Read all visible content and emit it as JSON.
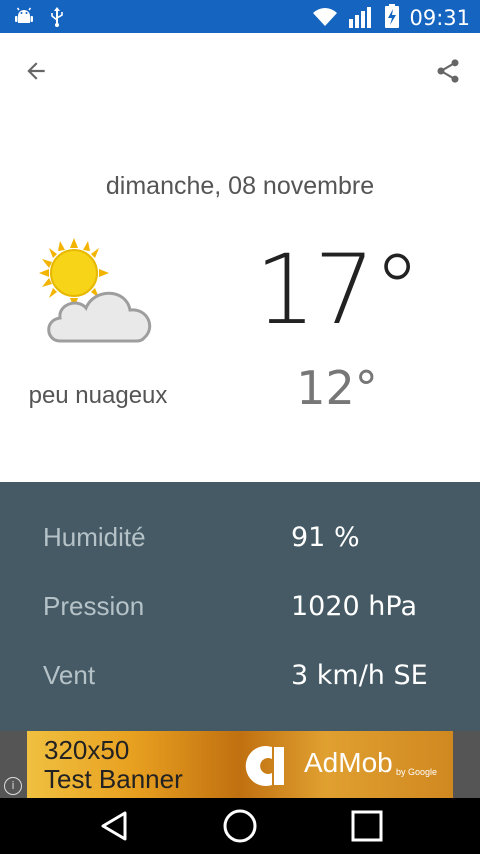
{
  "status_bar": {
    "time": "09:31",
    "icons": [
      "android-debug-icon",
      "usb-icon",
      "wifi-icon",
      "signal-icon",
      "battery-charging-icon"
    ]
  },
  "toolbar": {
    "back_icon": "arrow-left-icon",
    "share_icon": "share-icon"
  },
  "weather": {
    "date": "dimanche, 08 novembre",
    "icon": "partly-cloudy-icon",
    "condition": "peu nuageux",
    "temp_high": "17°",
    "temp_low": "12°"
  },
  "details": [
    {
      "label": "Humidité",
      "value": "91 %"
    },
    {
      "label": "Pression",
      "value": "1020 hPa"
    },
    {
      "label": "Vent",
      "value": "3 km/h SE"
    }
  ],
  "ad": {
    "line1": "320x50",
    "line2": "Test Banner",
    "brand": "AdMob",
    "brand_sub": "by Google",
    "info": "i"
  },
  "colors": {
    "status_bar": "#1565c0",
    "details_bg": "#455a64",
    "navbar": "#000000"
  }
}
